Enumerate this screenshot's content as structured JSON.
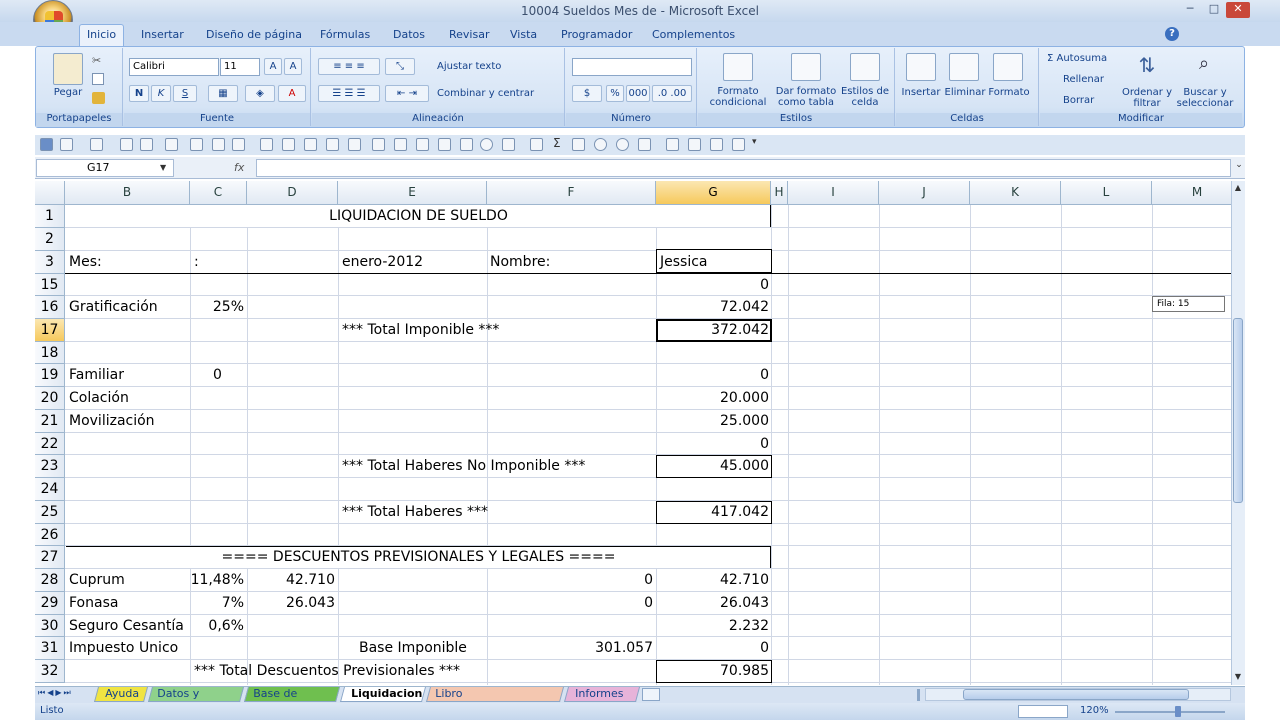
{
  "window": {
    "title": "10004 Sueldos Mes de  - Microsoft Excel",
    "controls": [
      "─",
      "□",
      "✕"
    ]
  },
  "tabs": [
    "Inicio",
    "Insertar",
    "Diseño de página",
    "Fórmulas",
    "Datos",
    "Revisar",
    "Vista",
    "Programador",
    "Complementos"
  ],
  "ribbon": {
    "portapapeles": {
      "group": "Portapapeles",
      "paste": "Pegar"
    },
    "fuente": {
      "group": "Fuente",
      "font": "Calibri",
      "size": "11",
      "bold": "N",
      "italic": "K",
      "underline": "S"
    },
    "alineacion": {
      "group": "Alineación",
      "wrap": "Ajustar texto",
      "merge": "Combinar y centrar"
    },
    "numero": {
      "group": "Número",
      "format": "",
      "percent": "%",
      "thousands": "000"
    },
    "estilos": {
      "group": "Estilos",
      "cond": "Formato condicional",
      "table": "Dar formato como tabla",
      "cell": "Estilos de celda"
    },
    "celdas": {
      "group": "Celdas",
      "insert": "Insertar",
      "delete": "Eliminar",
      "format": "Formato"
    },
    "modificar": {
      "group": "Modificar",
      "autosum": "Σ Autosuma",
      "fill": "Rellenar",
      "clear": "Borrar",
      "sort": "Ordenar y filtrar",
      "find": "Buscar y seleccionar"
    }
  },
  "formula_bar": {
    "name_box": "G17",
    "fx": "fx",
    "value": ""
  },
  "columns": [
    "B",
    "C",
    "D",
    "E",
    "F",
    "G",
    "H",
    "I",
    "J",
    "K",
    "L",
    "M"
  ],
  "selected_column": "G",
  "rows": [
    "1",
    "2",
    "3",
    "15",
    "16",
    "17",
    "18",
    "19",
    "20",
    "21",
    "22",
    "23",
    "24",
    "25",
    "26",
    "27",
    "28",
    "29",
    "30",
    "31",
    "32"
  ],
  "selected_row": "17",
  "cells": {
    "r1_title": "LIQUIDACION DE SUELDO",
    "r3_b": "Mes:",
    "r3_c": ":",
    "r3_e": "enero-2012",
    "r3_f": "Nombre:",
    "r3_g": "Jessica",
    "r15_g": "0",
    "r16_b": "Gratificación",
    "r16_c": "25%",
    "r16_g": "72.042",
    "r17_e": "*** Total Imponible ***",
    "r17_g": "372.042",
    "r19_b": "Familiar",
    "r19_c": "0",
    "r19_g": "0",
    "r20_b": "Colación",
    "r20_g": "20.000",
    "r21_b": "Movilización",
    "r21_g": "25.000",
    "r22_g": "0",
    "r23_e": "*** Total Haberes No Imponible ***",
    "r23_g": "45.000",
    "r25_e": "*** Total Haberes ***",
    "r25_g": "417.042",
    "r27_title": "==== DESCUENTOS PREVISIONALES Y LEGALES ====",
    "r28_b": "Cuprum",
    "r28_c": "11,48%",
    "r28_d": "42.710",
    "r28_f": "0",
    "r28_g": "42.710",
    "r29_b": "Fonasa",
    "r29_c": "7%",
    "r29_d": "26.043",
    "r29_f": "0",
    "r29_g": "26.043",
    "r30_b": "Seguro Cesantía",
    "r30_c": "0,6%",
    "r30_g": "2.232",
    "r31_b": "Impuesto Unico",
    "r31_e": "Base Imponible",
    "r31_f": "301.057",
    "r31_g": "0",
    "r32_c": "*** Total Descuentos Previsionales ***",
    "r32_g": "70.985"
  },
  "tooltip": "Fila: 15",
  "sheet_tabs": [
    {
      "name": "Ayuda",
      "color": "#f0e442"
    },
    {
      "name": "Datos y Tablas",
      "color": "#8fd18b"
    },
    {
      "name": "Base de Datos",
      "color": "#6fbf4f"
    },
    {
      "name": "Liquidacion",
      "color": "#ffffff"
    },
    {
      "name": "Libro Remuneraciones",
      "color": "#f4c7b0"
    },
    {
      "name": "Informes",
      "color": "#e7b3d9"
    }
  ],
  "status": {
    "ready": "Listo",
    "zoom": "120%"
  }
}
